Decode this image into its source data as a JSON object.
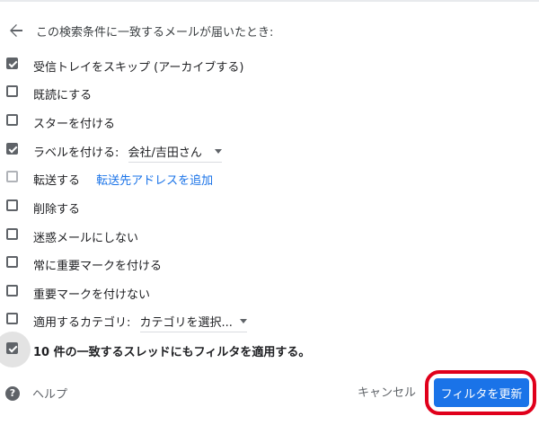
{
  "header": {
    "title": "この検索条件に一致するメールが届いたとき:"
  },
  "options": [
    {
      "label": "受信トレイをスキップ (アーカイブする)",
      "checked": true
    },
    {
      "label": "既読にする",
      "checked": false
    },
    {
      "label": "スターを付ける",
      "checked": false
    },
    {
      "label": "ラベルを付ける:",
      "checked": true,
      "dropdown_value": "会社/吉田さん"
    },
    {
      "label": "転送する",
      "checked": false,
      "link": "転送先アドレスを追加"
    },
    {
      "label": "削除する",
      "checked": false
    },
    {
      "label": "迷惑メールにしない",
      "checked": false
    },
    {
      "label": "常に重要マークを付ける",
      "checked": false
    },
    {
      "label": "重要マークを付けない",
      "checked": false
    },
    {
      "label": "適用するカテゴリ:",
      "checked": false,
      "dropdown_value": "カテゴリを選択..."
    },
    {
      "label": "10 件の一致するスレッドにもフィルタを適用する。",
      "checked": true
    }
  ],
  "footer": {
    "help_label": "ヘルプ",
    "cancel_label": "キャンセル",
    "update_label": "フィルタを更新"
  },
  "colors": {
    "primary": "#1a73e8",
    "highlight_ring": "#e0001b",
    "checkbox": "#5f6368"
  }
}
